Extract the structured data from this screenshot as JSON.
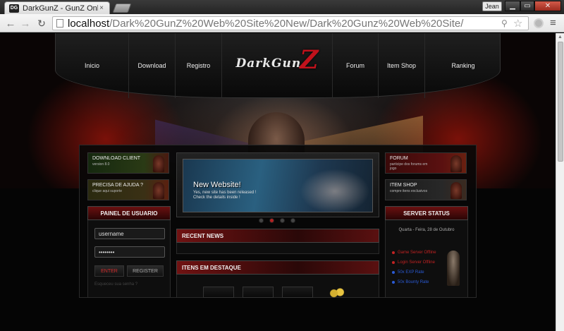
{
  "browser": {
    "tab_title": "DarkGunZ - GunZ Online",
    "favicon_text": "DG",
    "close_glyph": "×",
    "user_name": "Jean",
    "url_host": "localhost",
    "url_path": "/Dark%20GunZ%20Web%20Site%20New/Dark%20Gunz%20Web%20Site/",
    "icons": {
      "back": "←",
      "forward": "→",
      "reload": "↻",
      "search": "⚲",
      "star": "☆",
      "menu": "≡",
      "minimize": "▁",
      "maximize": "▭",
      "close": "✕",
      "scroll_up": "▲"
    }
  },
  "nav": {
    "items": [
      "Inicio",
      "Download",
      "Registro",
      "Forum",
      "Item Shop",
      "Ranking"
    ],
    "logo_text": "DarkGun",
    "logo_accent": "Z"
  },
  "left": {
    "download": {
      "title": "DOWNLOAD CLIENT",
      "sub": "version 8.0"
    },
    "help": {
      "title": "PRECISA DE AJUDA ?",
      "sub": "clique aqui suporte"
    },
    "user_panel": {
      "title": "PAINEL DE USUARIO",
      "username_value": "username",
      "password_value": "password",
      "enter_label": "ENTER",
      "register_label": "REGISTER",
      "forgot": "Esqueceu sua senha ?"
    }
  },
  "center": {
    "slide": {
      "title": "New Website!",
      "text_line1": "Yes, new site has been released !",
      "text_line2": "Check the details inside !"
    },
    "recent_news": "RECENT NEWS",
    "featured_items": "ITENS EM DESTAQUE"
  },
  "right": {
    "forum": {
      "title": "FORUM",
      "sub": "participe dos forums em\njogo"
    },
    "item_shop": {
      "title": "ITEM SHOP",
      "sub": "compre itens exclusivos"
    },
    "server_status": {
      "title": "SERVER STATUS",
      "date": "Quarta - Feira, 28 de Outubro",
      "lines": [
        {
          "text": "Game Server Offline",
          "color": "#c22222"
        },
        {
          "text": "Login Server Offline",
          "color": "#c22222"
        },
        {
          "text": "50x EXP Rate",
          "color": "#2a5ad4"
        },
        {
          "text": "50x Bounty Rate",
          "color": "#2a5ad4"
        }
      ]
    }
  },
  "colors": {
    "accent_red": "#c1121c",
    "panel_red": "#6a1010",
    "offline": "#c22222",
    "rate": "#2a5ad4"
  }
}
